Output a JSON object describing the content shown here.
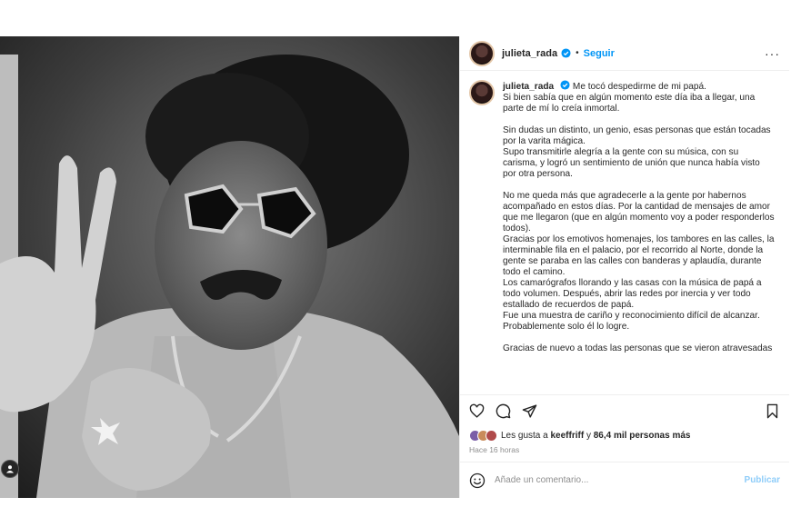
{
  "post": {
    "username": "julieta_rada",
    "follow_label": "Seguir",
    "separator": "•",
    "more_label": "···",
    "caption": {
      "username": "julieta_rada",
      "paragraphs": [
        "Me tocó despedirme de mi papá.\nSi bien sabía que en algún momento este día iba a llegar, una parte de mí lo creía inmortal.",
        "Sin dudas un distinto, un genio, esas personas que están tocadas por la varita mágica.\nSupo transmitirle alegría a la gente con su música, con su carisma, y logró un sentimiento de unión que nunca había visto por otra persona.",
        "No me queda más que agradecerle a la gente por habernos acompañado en estos días. Por la cantidad de mensajes de amor que me llegaron (que en algún momento voy a poder responderlos todos).\nGracias por los emotivos homenajes, los tambores en las calles, la interminable fila en el palacio, por el recorrido al Norte, donde la gente se paraba en las calles con banderas y aplaudía, durante todo el camino.\nLos camarógrafos llorando y las casas con la música de papá a todo volumen. Después, abrir las redes por inercia y ver todo estallado de recuerdos de papá.\nFue una muestra de cariño y reconocimiento difícil de alcanzar. Probablemente solo él lo logre.",
        "Gracias de nuevo a todas las personas que se vieron atravesadas"
      ]
    },
    "likes": {
      "prefix": "Les gusta a",
      "user": "keeffriff",
      "middle": "y",
      "count": "86,4 mil personas más"
    },
    "time_ago": "Hace 16 horas",
    "comment": {
      "placeholder": "Añade un comentario...",
      "publish_label": "Publicar"
    }
  },
  "colors": {
    "accent": "#0095f6",
    "publish_disabled": "#8fcdf9",
    "muted": "#8e8e8e",
    "text": "#262626"
  },
  "icons": [
    "verified-badge-icon",
    "more-options-icon",
    "heart-icon",
    "comment-icon",
    "share-icon",
    "bookmark-icon",
    "emoji-icon",
    "tagged-user-icon"
  ]
}
